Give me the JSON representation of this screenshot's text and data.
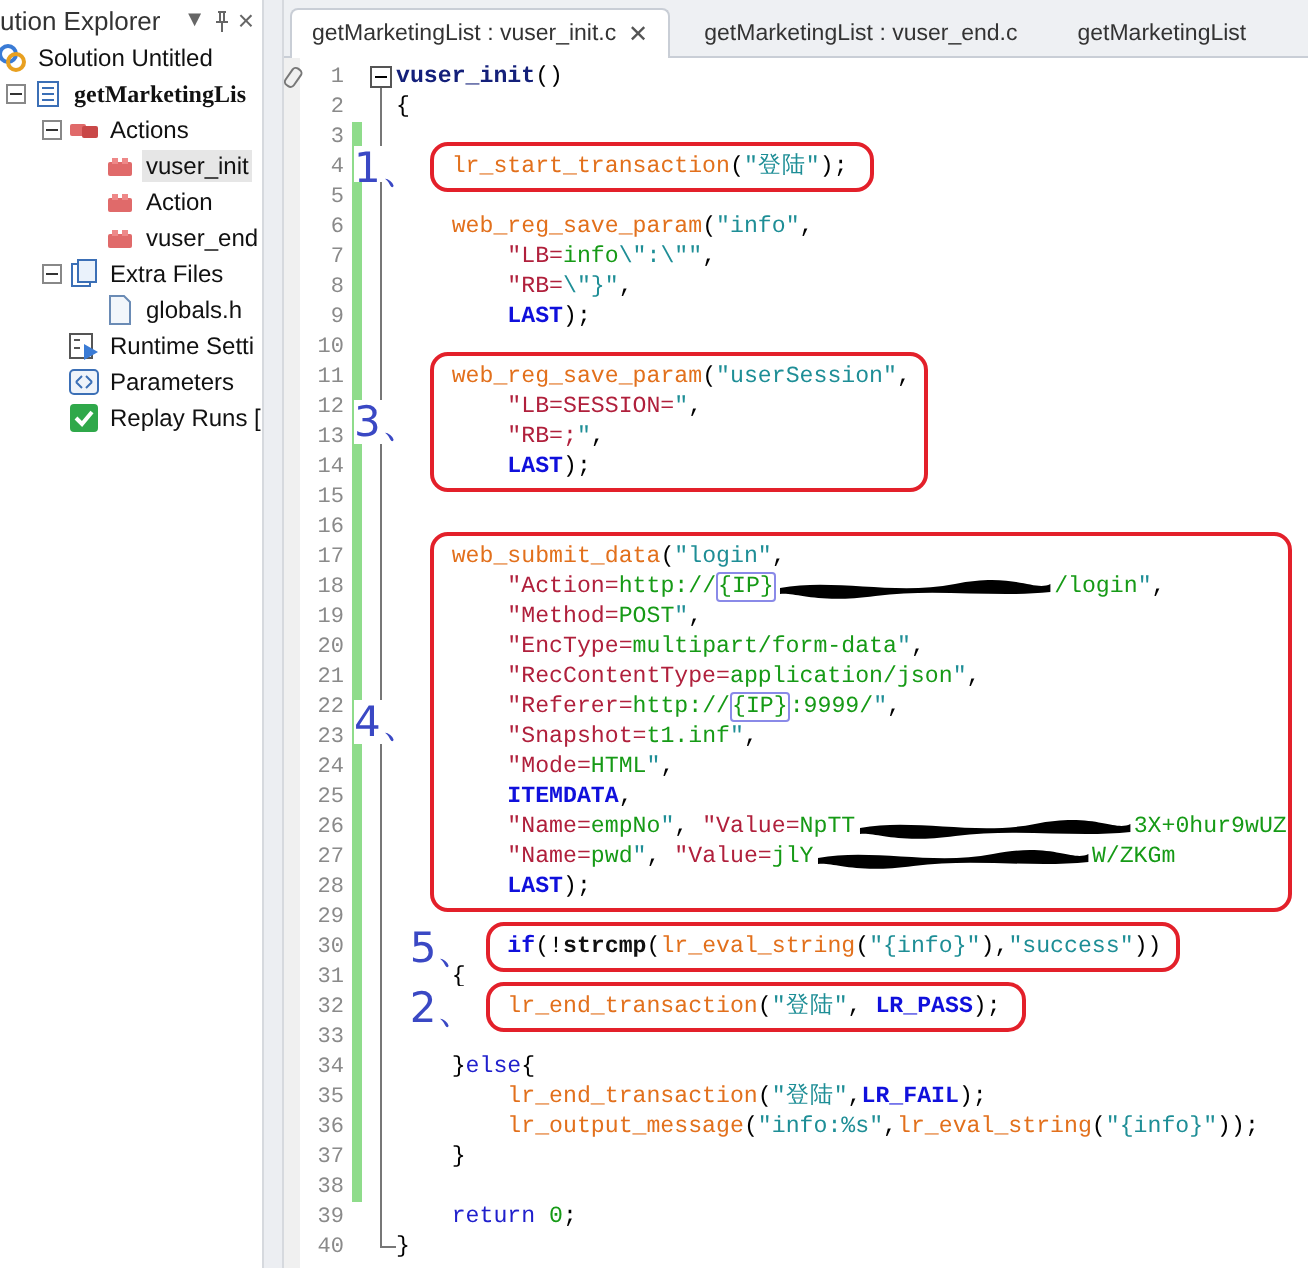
{
  "explorer": {
    "title": "ution Explorer",
    "buttons": [
      "▼",
      "×"
    ],
    "tree": [
      {
        "label": "Solution Untitled",
        "kind": "solution",
        "selected": false,
        "children": [
          {
            "label": "getMarketingLis",
            "kind": "script",
            "selected": false,
            "expanded": true,
            "children": [
              {
                "label": "Actions",
                "kind": "actions",
                "selected": false,
                "expanded": true,
                "children": [
                  {
                    "label": "vuser_init",
                    "kind": "action",
                    "selected": true
                  },
                  {
                    "label": "Action",
                    "kind": "action",
                    "selected": false
                  },
                  {
                    "label": "vuser_end",
                    "kind": "action",
                    "selected": false
                  }
                ]
              },
              {
                "label": "Extra Files",
                "kind": "files",
                "selected": false,
                "expanded": true,
                "children": [
                  {
                    "label": "globals.h",
                    "kind": "file",
                    "selected": false
                  }
                ]
              },
              {
                "label": "Runtime Setti",
                "kind": "settings",
                "selected": false
              },
              {
                "label": "Parameters",
                "kind": "parameters",
                "selected": false
              },
              {
                "label": "Replay Runs [",
                "kind": "runs",
                "selected": false
              }
            ]
          }
        ]
      }
    ]
  },
  "tabs": [
    {
      "label": "getMarketingList : vuser_init.c",
      "selected": true,
      "close": "✕"
    },
    {
      "label": "getMarketingList : vuser_end.c",
      "selected": false
    },
    {
      "label": "getMarketingList",
      "selected": false
    }
  ],
  "editor": {
    "blocks": [
      {
        "lines": [
          {
            "n": "1",
            "changed": false,
            "kind": "fold_start",
            "tokens": [
              {
                "kind": "func_def",
                "text": "vuser_init"
              },
              {
                "kind": "punct",
                "text": "()"
              }
            ]
          },
          {
            "n": "2",
            "changed": false,
            "kind": "top",
            "tokens": [
              {
                "kind": "punct",
                "text": "{"
              }
            ]
          },
          {
            "n": "3",
            "changed": true,
            "kind": "top"
          }
        ]
      },
      {
        "annotation": "1、",
        "lines": [
          {
            "n": "4",
            "changed": true,
            "kind": "inner",
            "tokens": [
              {
                "kind": "func",
                "text": "lr_start_transaction"
              },
              {
                "kind": "punct",
                "text": "("
              },
              {
                "kind": "string",
                "text": "\"登陆\""
              },
              {
                "kind": "punct",
                "text": ");"
              }
            ]
          }
        ]
      },
      {
        "lines": [
          {
            "n": "5",
            "changed": true,
            "kind": "top"
          },
          {
            "n": "6",
            "changed": true,
            "kind": "inner",
            "tokens": [
              {
                "kind": "func",
                "text": "web_reg_save_param"
              },
              {
                "kind": "punct",
                "text": "("
              },
              {
                "kind": "string",
                "text": "\"info\""
              },
              {
                "kind": "punct",
                "text": ","
              }
            ]
          },
          {
            "n": "7",
            "changed": true,
            "kind": "deep",
            "tokens": [
              {
                "kind": "attr",
                "text": "\"LB="
              },
              {
                "kind": "value",
                "text": "info"
              },
              {
                "kind": "string",
                "text": "\\\":\\\"\""
              },
              {
                "kind": "punct",
                "text": ","
              }
            ]
          },
          {
            "n": "8",
            "changed": true,
            "kind": "deep",
            "tokens": [
              {
                "kind": "attr",
                "text": "\"RB="
              },
              {
                "kind": "string",
                "text": "\\\"}\""
              },
              {
                "kind": "punct",
                "text": ","
              }
            ]
          },
          {
            "n": "9",
            "changed": true,
            "kind": "deep",
            "tokens": [
              {
                "kind": "constant",
                "text": "LAST"
              },
              {
                "kind": "punct",
                "text": ");"
              }
            ]
          },
          {
            "n": "10",
            "changed": true,
            "kind": "top"
          }
        ]
      },
      {
        "annotation": "3、",
        "lines": [
          {
            "n": "11",
            "changed": true,
            "kind": "inner",
            "tokens": [
              {
                "kind": "func",
                "text": "web_reg_save_param"
              },
              {
                "kind": "punct",
                "text": "("
              },
              {
                "kind": "string",
                "text": "\"userSession\""
              },
              {
                "kind": "punct",
                "text": ","
              }
            ]
          },
          {
            "n": "12",
            "changed": true,
            "kind": "deep",
            "tokens": [
              {
                "kind": "attr",
                "text": "\"LB=SESSION="
              },
              {
                "kind": "string",
                "text": "\""
              },
              {
                "kind": "punct",
                "text": ","
              }
            ]
          },
          {
            "n": "13",
            "changed": true,
            "kind": "deep",
            "tokens": [
              {
                "kind": "attr",
                "text": "\"RB=;"
              },
              {
                "kind": "string",
                "text": "\""
              },
              {
                "kind": "punct",
                "text": ","
              }
            ]
          },
          {
            "n": "14",
            "changed": true,
            "kind": "deep",
            "tokens": [
              {
                "kind": "constant",
                "text": "LAST"
              },
              {
                "kind": "punct",
                "text": ");"
              }
            ]
          }
        ]
      },
      {
        "lines": [
          {
            "n": "15",
            "changed": true,
            "kind": "top"
          },
          {
            "n": "16",
            "changed": true,
            "kind": "top"
          }
        ]
      },
      {
        "annotation": "4、",
        "lines": [
          {
            "n": "17",
            "changed": true,
            "kind": "inner",
            "tokens": [
              {
                "kind": "func",
                "text": "web_submit_data"
              },
              {
                "kind": "punct",
                "text": "("
              },
              {
                "kind": "string",
                "text": "\"login\""
              },
              {
                "kind": "punct",
                "text": ","
              }
            ]
          },
          {
            "n": "18",
            "changed": true,
            "kind": "deep",
            "tokens": [
              {
                "kind": "attr",
                "text": "\"Action="
              },
              {
                "kind": "value",
                "text": "http://"
              },
              {
                "kind": "param_ref",
                "text": "{IP}"
              },
              {
                "kind": "redacted"
              },
              {
                "kind": "value",
                "text": "/login"
              },
              {
                "kind": "string",
                "text": "\""
              },
              {
                "kind": "punct",
                "text": ","
              }
            ]
          },
          {
            "n": "19",
            "changed": true,
            "kind": "deep",
            "tokens": [
              {
                "kind": "attr",
                "text": "\"Method="
              },
              {
                "kind": "value",
                "text": "POST"
              },
              {
                "kind": "string",
                "text": "\""
              },
              {
                "kind": "punct",
                "text": ","
              }
            ]
          },
          {
            "n": "20",
            "changed": true,
            "kind": "deep",
            "tokens": [
              {
                "kind": "attr",
                "text": "\"EncType="
              },
              {
                "kind": "value",
                "text": "multipart/form-data"
              },
              {
                "kind": "string",
                "text": "\""
              },
              {
                "kind": "punct",
                "text": ","
              }
            ]
          },
          {
            "n": "21",
            "changed": true,
            "kind": "deep",
            "tokens": [
              {
                "kind": "attr",
                "text": "\"RecContentType="
              },
              {
                "kind": "value",
                "text": "application/json"
              },
              {
                "kind": "string",
                "text": "\""
              },
              {
                "kind": "punct",
                "text": ","
              }
            ]
          },
          {
            "n": "22",
            "changed": true,
            "kind": "deep",
            "tokens": [
              {
                "kind": "attr",
                "text": "\"Referer="
              },
              {
                "kind": "value",
                "text": "http://"
              },
              {
                "kind": "param_ref",
                "text": "{IP}"
              },
              {
                "kind": "value",
                "text": ":9999/"
              },
              {
                "kind": "string",
                "text": "\""
              },
              {
                "kind": "punct",
                "text": ","
              }
            ]
          },
          {
            "n": "23",
            "changed": true,
            "kind": "deep",
            "tokens": [
              {
                "kind": "attr",
                "text": "\"Snapshot="
              },
              {
                "kind": "value",
                "text": "t1.inf"
              },
              {
                "kind": "string",
                "text": "\""
              },
              {
                "kind": "punct",
                "text": ","
              }
            ]
          },
          {
            "n": "24",
            "changed": true,
            "kind": "deep",
            "tokens": [
              {
                "kind": "attr",
                "text": "\"Mode="
              },
              {
                "kind": "value",
                "text": "HTML"
              },
              {
                "kind": "string",
                "text": "\""
              },
              {
                "kind": "punct",
                "text": ","
              }
            ]
          },
          {
            "n": "25",
            "changed": true,
            "kind": "deep",
            "tokens": [
              {
                "kind": "constant",
                "text": "ITEMDATA"
              },
              {
                "kind": "punct",
                "text": ","
              }
            ]
          },
          {
            "n": "26",
            "changed": true,
            "kind": "deep",
            "tokens": [
              {
                "kind": "attr",
                "text": "\"Name="
              },
              {
                "kind": "value",
                "text": "empNo"
              },
              {
                "kind": "string",
                "text": "\""
              },
              {
                "kind": "punct",
                "text": ", "
              },
              {
                "kind": "attr",
                "text": "\"Value="
              },
              {
                "kind": "value",
                "text": "NpTT"
              },
              {
                "kind": "redacted"
              },
              {
                "kind": "value",
                "text": "3X+0hur9wUZ"
              }
            ]
          },
          {
            "n": "27",
            "changed": true,
            "kind": "deep",
            "tokens": [
              {
                "kind": "attr",
                "text": "\"Name="
              },
              {
                "kind": "value",
                "text": "pwd"
              },
              {
                "kind": "string",
                "text": "\""
              },
              {
                "kind": "punct",
                "text": ", "
              },
              {
                "kind": "attr",
                "text": "\"Value="
              },
              {
                "kind": "value",
                "text": "jlY"
              },
              {
                "kind": "redacted"
              },
              {
                "kind": "value",
                "text": "W/ZKGm"
              }
            ]
          },
          {
            "n": "28",
            "changed": true,
            "kind": "deep",
            "tokens": [
              {
                "kind": "constant",
                "text": "LAST"
              },
              {
                "kind": "punct",
                "text": ");"
              }
            ]
          }
        ]
      },
      {
        "lines": [
          {
            "n": "29",
            "changed": true,
            "kind": "top"
          }
        ]
      },
      {
        "annotation": "5、",
        "lines": [
          {
            "n": "30",
            "changed": true,
            "kind": "deep",
            "tokens": [
              {
                "kind": "constant",
                "text": "if"
              },
              {
                "kind": "punct",
                "text": "(!"
              },
              {
                "kind": "builtin",
                "text": "strcmp"
              },
              {
                "kind": "punct",
                "text": "("
              },
              {
                "kind": "func",
                "text": "lr_eval_string"
              },
              {
                "kind": "punct",
                "text": "("
              },
              {
                "kind": "string",
                "text": "\"{info}\""
              },
              {
                "kind": "punct",
                "text": "),"
              },
              {
                "kind": "string",
                "text": "\"success\""
              },
              {
                "kind": "punct",
                "text": "))"
              }
            ]
          }
        ]
      },
      {
        "lines": [
          {
            "n": "31",
            "changed": true,
            "kind": "inner",
            "tokens": [
              {
                "kind": "punct",
                "text": "{"
              }
            ]
          }
        ]
      },
      {
        "annotation": "2、",
        "lines": [
          {
            "n": "32",
            "changed": true,
            "kind": "deep",
            "tokens": [
              {
                "kind": "func",
                "text": "lr_end_transaction"
              },
              {
                "kind": "punct",
                "text": "("
              },
              {
                "kind": "string",
                "text": "\"登陆\""
              },
              {
                "kind": "punct",
                "text": ", "
              },
              {
                "kind": "constant",
                "text": "LR_PASS"
              },
              {
                "kind": "punct",
                "text": ");"
              }
            ]
          }
        ]
      },
      {
        "lines": [
          {
            "n": "33",
            "changed": true,
            "kind": "top"
          },
          {
            "n": "34",
            "changed": true,
            "kind": "inner",
            "tokens": [
              {
                "kind": "punct",
                "text": "}"
              },
              {
                "kind": "keyword",
                "text": "else"
              },
              {
                "kind": "punct",
                "text": "{"
              }
            ]
          },
          {
            "n": "35",
            "changed": true,
            "kind": "deep",
            "tokens": [
              {
                "kind": "func",
                "text": "lr_end_transaction"
              },
              {
                "kind": "punct",
                "text": "("
              },
              {
                "kind": "string",
                "text": "\"登陆\""
              },
              {
                "kind": "punct",
                "text": ","
              },
              {
                "kind": "constant",
                "text": "LR_FAIL"
              },
              {
                "kind": "punct",
                "text": ");"
              }
            ]
          },
          {
            "n": "36",
            "changed": true,
            "kind": "deep",
            "tokens": [
              {
                "kind": "func",
                "text": "lr_output_message"
              },
              {
                "kind": "punct",
                "text": "("
              },
              {
                "kind": "string",
                "text": "\"info:%s\""
              },
              {
                "kind": "punct",
                "text": ","
              },
              {
                "kind": "func",
                "text": "lr_eval_string"
              },
              {
                "kind": "punct",
                "text": "("
              },
              {
                "kind": "string",
                "text": "\"{info}\""
              },
              {
                "kind": "punct",
                "text": "));"
              }
            ]
          },
          {
            "n": "37",
            "changed": true,
            "kind": "inner",
            "tokens": [
              {
                "kind": "punct",
                "text": "}"
              }
            ]
          },
          {
            "n": "38",
            "changed": true,
            "kind": "top"
          },
          {
            "n": "39",
            "changed": false,
            "kind": "inner",
            "tokens": [
              {
                "kind": "keyword",
                "text": "return "
              },
              {
                "kind": "number",
                "text": "0"
              },
              {
                "kind": "punct",
                "text": ";"
              }
            ]
          },
          {
            "n": "40",
            "changed": false,
            "kind": "fold_end",
            "tokens": [
              {
                "kind": "punct",
                "text": "}"
              }
            ]
          }
        ]
      }
    ]
  }
}
